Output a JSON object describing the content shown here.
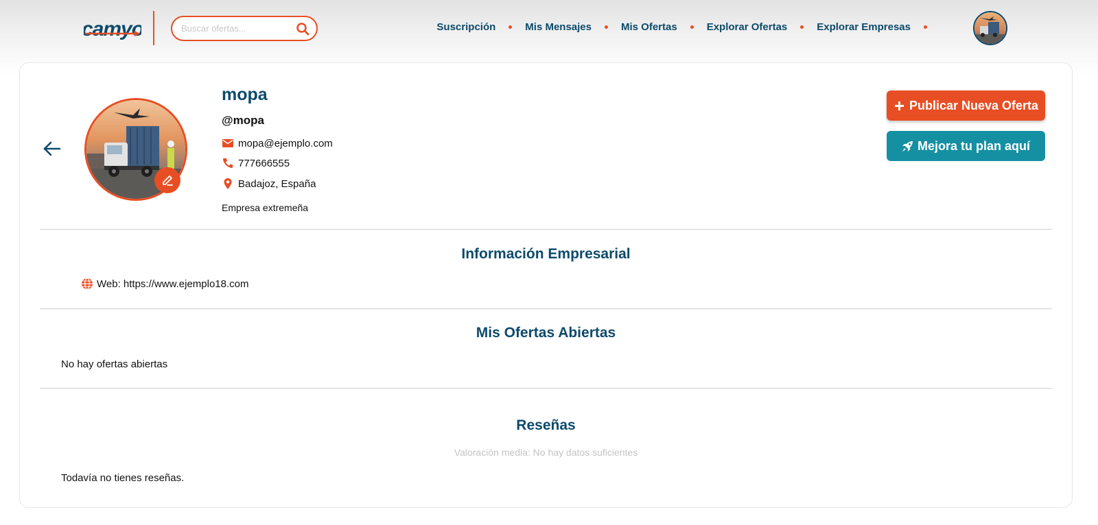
{
  "header": {
    "logo_text": "camyo",
    "search": {
      "placeholder": "Buscar ofertas...",
      "value": ""
    },
    "nav": [
      {
        "label": "Suscripción"
      },
      {
        "label": "Mis Mensajes"
      },
      {
        "label": "Mis Ofertas"
      },
      {
        "label": "Explorar Ofertas"
      },
      {
        "label": "Explorar Empresas"
      }
    ]
  },
  "profile": {
    "name": "mopa",
    "handle": "@mopa",
    "email": "mopa@ejemplo.com",
    "phone": "777666555",
    "location": "Badajoz, España",
    "description": "Empresa extremeña"
  },
  "actions": {
    "publish": "Publicar Nueva Oferta",
    "upgrade": "Mejora tu plan aquí"
  },
  "business_info": {
    "title": "Información Empresarial",
    "web": "Web: https://www.ejemplo18.com"
  },
  "open_offers": {
    "title": "Mis Ofertas Abiertas",
    "empty": "No hay ofertas abiertas"
  },
  "reviews": {
    "title": "Reseñas",
    "average": "Valoración media: No hay datos suficientes",
    "empty": "Todavía no tienes reseñas."
  },
  "colors": {
    "accent": "#e84e23",
    "primary": "#0d4a6b",
    "teal": "#1590a3"
  }
}
